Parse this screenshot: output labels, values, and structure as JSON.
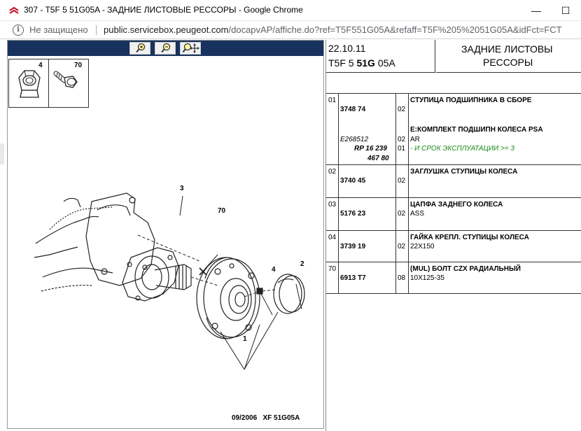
{
  "window": {
    "title": "307 - T5F 5 51G05A - ЗАДНИЕ ЛИСТОВЫЕ РЕССОРЫ - Google Chrome",
    "minimize_glyph": "—",
    "maximize_glyph": "☐"
  },
  "address": {
    "security_label": "Не защищено",
    "host": "public.servicebox.peugeot.com",
    "path": "/docapvAP/affiche.do?ref=T5F551G05A&refaff=T5F%205%2051G05A&idFct=FCT"
  },
  "toolbar": {
    "icons": [
      "zoom-in-icon",
      "zoom-out-icon",
      "zoom-pan-icon"
    ]
  },
  "diagram": {
    "parts_box": {
      "nut_number": "4",
      "bolt_number": "70"
    },
    "callouts": {
      "c3": "3",
      "c70": "70",
      "c4": "4",
      "c2": "2",
      "c1": "1"
    },
    "footer_date": "09/2006",
    "footer_code": "XF 51G05A"
  },
  "header": {
    "date": "22.10.11",
    "code_prefix": "T5F 5 ",
    "code_bold": "51G",
    "code_suffix": " 05A",
    "title_line1": "ЗАДНИЕ ЛИСТОВЫ",
    "title_line2": "РЕССОРЫ"
  },
  "parts": [
    {
      "pos": "01",
      "ref": "3748 74",
      "qty": "02",
      "name": "СТУПИЦА ПОДШИПНИКА В СБОРЕ",
      "sub_name": "Е:КОМПЛЕКТ ПОДШИПН КОЛЕСА PSA",
      "sub_note": "AR",
      "sub_ref": "E268512",
      "sub_qty": "02",
      "alt_ref1": "RP 16 239",
      "alt_ref2": "467 80",
      "alt_qty": "01",
      "green_note": "- И СРОК ЭКСПЛУАТАЦИИ >= 3"
    },
    {
      "pos": "02",
      "ref": "3740 45",
      "qty": "02",
      "name": "ЗАГЛУШКА СТУПИЦЫ КОЛЕСА",
      "note": ""
    },
    {
      "pos": "03",
      "ref": "5176 23",
      "qty": "02",
      "name": "ЦАПФА ЗАДНЕГО КОЛЕСА",
      "note": "ASS"
    },
    {
      "pos": "04",
      "ref": "3739 19",
      "qty": "02",
      "name": "ГАЙКА КРЕПЛ. СТУПИЦЫ КОЛЕСА",
      "note": "22X150"
    },
    {
      "pos": "70",
      "ref": "6913 T7",
      "qty": "08",
      "name": "(MUL) БОЛТ CZX РАДИАЛЬНЫЙ",
      "note": "10X125-35"
    }
  ]
}
